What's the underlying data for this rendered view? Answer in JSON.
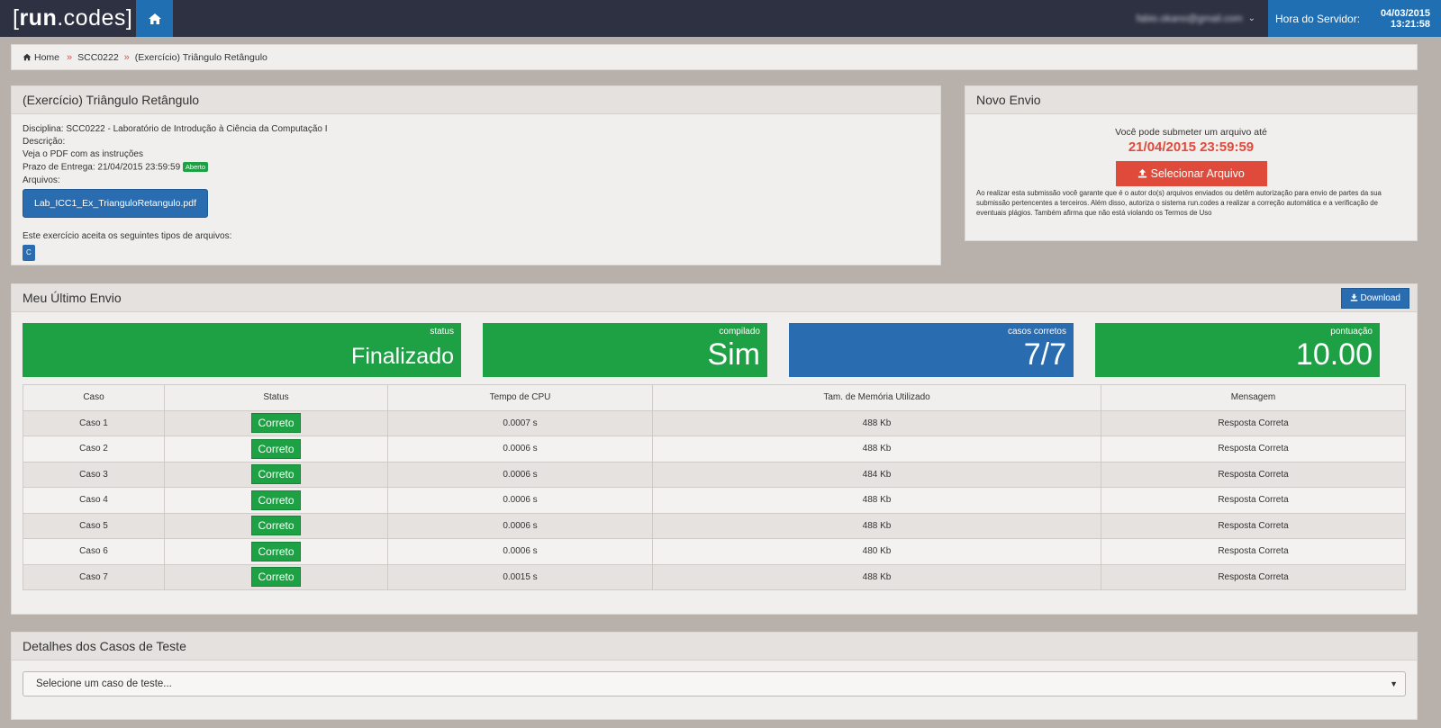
{
  "app": {
    "logo_bracket_open": "[",
    "logo_bold": "run",
    "logo_rest": ".codes",
    "logo_bracket_close": "]",
    "user_email": "fabio.okano@gmail.com",
    "server_time_label": "Hora do Servidor:",
    "server_date": "04/03/2015",
    "server_clock": "13:21:58"
  },
  "breadcrumb": {
    "home": "Home",
    "course": "SCC0222",
    "current": "(Exercício) Triângulo Retângulo"
  },
  "exercise": {
    "title": "(Exercício) Triângulo Retângulo",
    "discipline": "Disciplina: SCC0222 - Laboratório de Introdução à Ciência da Computação I",
    "description_label": "Descrição:",
    "description": "Veja o PDF com as instruções",
    "deadline": "Prazo de Entrega: 21/04/2015 23:59:59",
    "deadline_badge": "Aberto",
    "files_label": "Arquivos:",
    "file_name": "Lab_ICC1_Ex_TrianguloRetangulo.pdf",
    "types_label": "Este exercício aceita os seguintes tipos de arquivos:",
    "type": "C"
  },
  "novo": {
    "title": "Novo Envio",
    "line": "Você pode submeter um arquivo até",
    "date": "21/04/2015 23:59:59",
    "button": "Selecionar Arquivo",
    "notice": "Ao realizar esta submissão você garante que é o autor do(s) arquivos enviados ou detêm autorização para envio de partes da sua submissão pertencentes a terceiros. Além disso, autoriza o sistema run.codes a realizar a correção automática e a verificação de eventuais plágios. Também afirma que não está violando os Termos de Uso"
  },
  "envio": {
    "title": "Meu Último Envio",
    "download": "Download",
    "stats": [
      {
        "label": "status",
        "value": "Finalizado",
        "color": "#1ea144"
      },
      {
        "label": "compilado",
        "value": "Sim",
        "color": "#1ea144"
      },
      {
        "label": "casos corretos",
        "value": "7/7",
        "color": "#2a6cb0"
      },
      {
        "label": "pontuação",
        "value": "10.00",
        "color": "#1ea144"
      }
    ],
    "columns": [
      "Caso",
      "Status",
      "Tempo de CPU",
      "Tam. de Memória Utilizado",
      "Mensagem"
    ],
    "rows": [
      {
        "caso": "Caso 1",
        "status": "Correto",
        "cpu": "0.0007 s",
        "mem": "488 Kb",
        "msg": "Resposta Correta"
      },
      {
        "caso": "Caso 2",
        "status": "Correto",
        "cpu": "0.0006 s",
        "mem": "488 Kb",
        "msg": "Resposta Correta"
      },
      {
        "caso": "Caso 3",
        "status": "Correto",
        "cpu": "0.0006 s",
        "mem": "484 Kb",
        "msg": "Resposta Correta"
      },
      {
        "caso": "Caso 4",
        "status": "Correto",
        "cpu": "0.0006 s",
        "mem": "488 Kb",
        "msg": "Resposta Correta"
      },
      {
        "caso": "Caso 5",
        "status": "Correto",
        "cpu": "0.0006 s",
        "mem": "488 Kb",
        "msg": "Resposta Correta"
      },
      {
        "caso": "Caso 6",
        "status": "Correto",
        "cpu": "0.0006 s",
        "mem": "480 Kb",
        "msg": "Resposta Correta"
      },
      {
        "caso": "Caso 7",
        "status": "Correto",
        "cpu": "0.0015 s",
        "mem": "488 Kb",
        "msg": "Resposta Correta"
      }
    ]
  },
  "details": {
    "title": "Detalhes dos Casos de Teste",
    "select_placeholder": "Selecione um caso de teste..."
  },
  "icons": {
    "home": "home-icon",
    "upload": "upload-icon",
    "download": "download-icon",
    "caret": "chevron-down-icon"
  }
}
